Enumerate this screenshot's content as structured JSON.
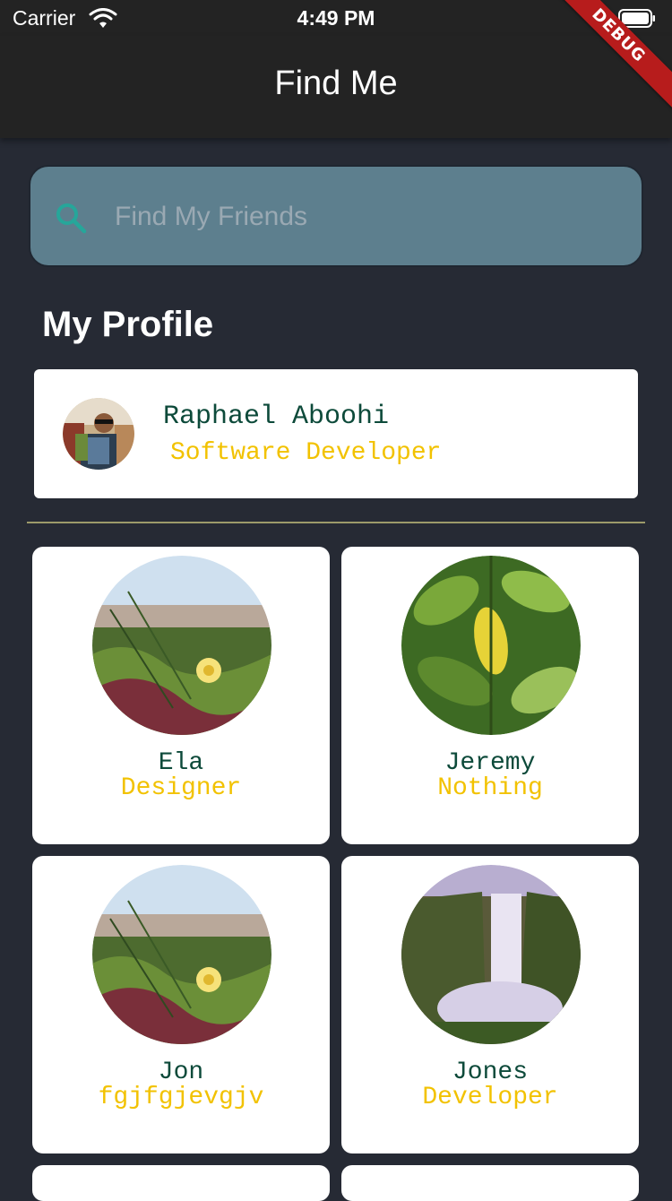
{
  "status_bar": {
    "carrier": "Carrier",
    "time": "4:49 PM"
  },
  "debug_banner": "DEBUG",
  "app_bar": {
    "title": "Find Me"
  },
  "search": {
    "placeholder": "Find My Friends",
    "value": ""
  },
  "profile_section": {
    "heading": "My Profile",
    "name": "Raphael Aboohi",
    "role": "Software Developer"
  },
  "friends": [
    {
      "name": "Ela",
      "role": "Designer",
      "image": "flower-field"
    },
    {
      "name": "Jeremy",
      "role": "Nothing",
      "image": "lemon-leaves"
    },
    {
      "name": "Jon",
      "role": "fgjfgjevgjv",
      "image": "flower-field"
    },
    {
      "name": "Jones",
      "role": "Developer",
      "image": "waterfall"
    }
  ],
  "colors": {
    "background": "#262a34",
    "app_bar": "#232323",
    "search_fill": "#5d7f8e",
    "search_icon": "#26a69a",
    "name_text": "#0d4a3a",
    "role_text": "#f2c200",
    "debug_ribbon": "#b71c1c"
  }
}
